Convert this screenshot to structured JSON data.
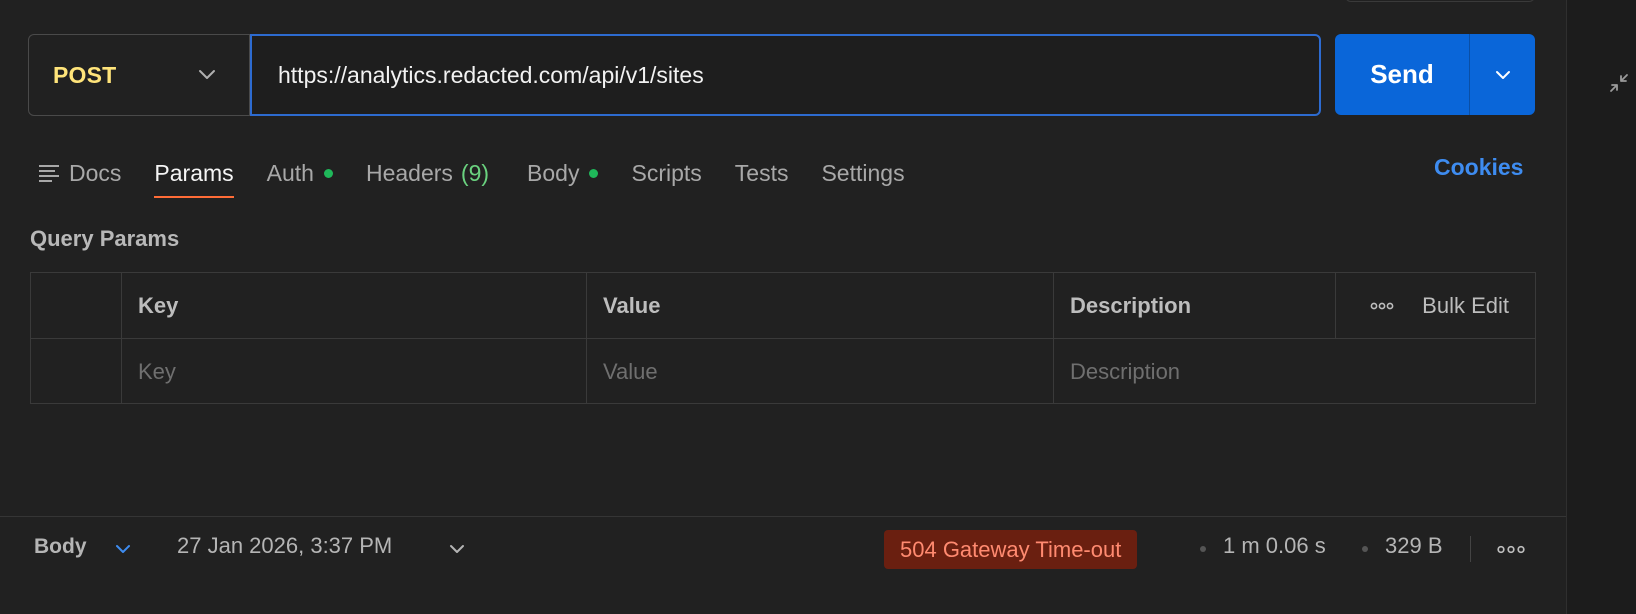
{
  "request": {
    "method": "POST",
    "url": "https://analytics.redacted.com/api/v1/sites",
    "send_label": "Send"
  },
  "tabs": [
    {
      "label": "Docs"
    },
    {
      "label": "Params"
    },
    {
      "label": "Auth"
    },
    {
      "label": "Headers",
      "count": "(9)"
    },
    {
      "label": "Body"
    },
    {
      "label": "Scripts"
    },
    {
      "label": "Tests"
    },
    {
      "label": "Settings"
    }
  ],
  "cookies_label": "Cookies",
  "query_params": {
    "title": "Query Params",
    "headers": [
      "Key",
      "Value",
      "Description"
    ],
    "bulk_edit_label": "Bulk Edit",
    "placeholders": [
      "Key",
      "Value",
      "Description"
    ]
  },
  "response": {
    "body_label": "Body",
    "timestamp": "27 Jan 2026, 3:37 PM",
    "status": "504 Gateway Time-out",
    "duration": "1 m 0.06 s",
    "size": "329 B"
  },
  "colors": {
    "accent_blue": "#0a66d9",
    "method_post": "#ffe47a",
    "active_tab_underline": "#ff6c37",
    "status_dot": "#1fb85a",
    "error_badge_bg": "#6a1f10",
    "error_badge_text": "#ff8a70"
  },
  "icons": [
    "chevron-down-icon",
    "docs-icon",
    "more-horizontal-icon",
    "collapse-arrows-icon"
  ]
}
